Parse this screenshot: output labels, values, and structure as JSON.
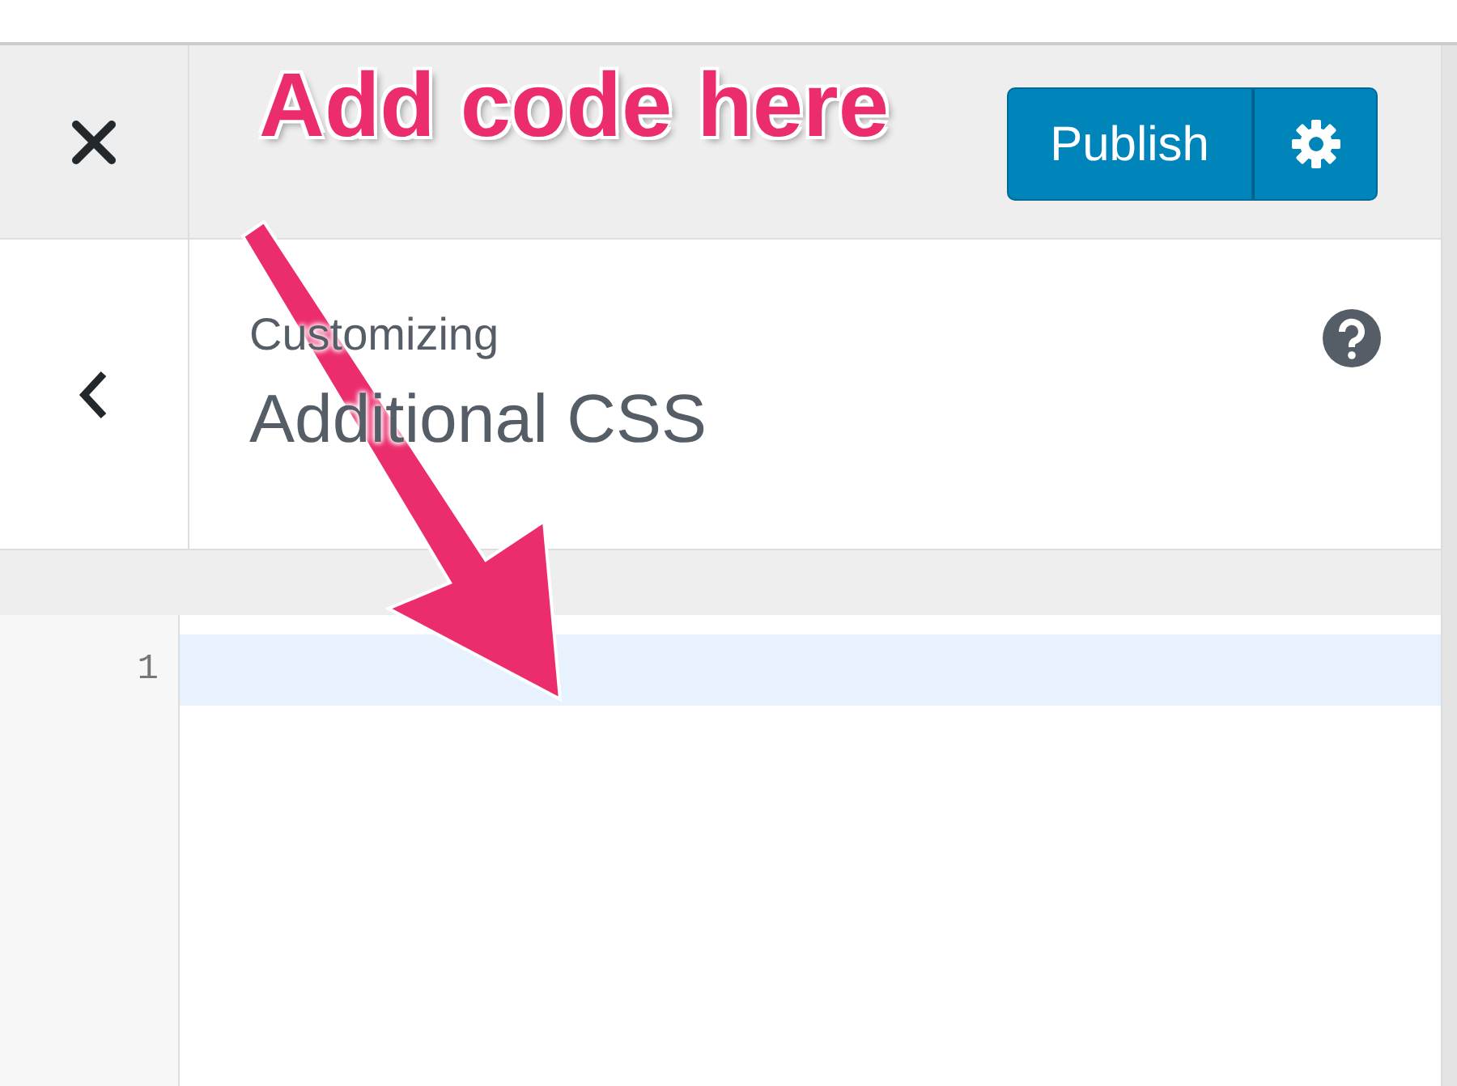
{
  "annotation": {
    "text": "Add code here"
  },
  "header": {
    "publish_label": "Publish"
  },
  "section": {
    "breadcrumb": "Customizing",
    "title": "Additional CSS"
  },
  "editor": {
    "lines": [
      {
        "number": "1",
        "active": true
      }
    ]
  }
}
